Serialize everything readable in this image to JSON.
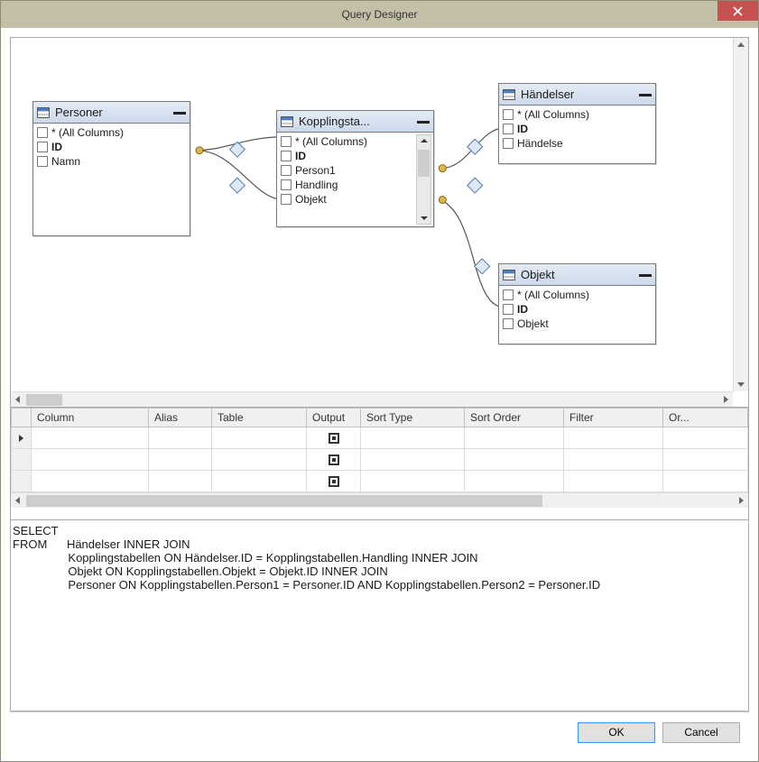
{
  "window": {
    "title": "Query Designer"
  },
  "tables": {
    "personer": {
      "title": "Personer",
      "cols": [
        {
          "label": "* (All Columns)",
          "bold": false
        },
        {
          "label": "ID",
          "bold": true
        },
        {
          "label": "Namn",
          "bold": false
        }
      ]
    },
    "kopplingsta": {
      "title": "Kopplingsta...",
      "cols": [
        {
          "label": "* (All Columns)",
          "bold": false
        },
        {
          "label": "ID",
          "bold": true
        },
        {
          "label": "Person1",
          "bold": false
        },
        {
          "label": "Handling",
          "bold": false
        },
        {
          "label": "Objekt",
          "bold": false
        }
      ]
    },
    "handelser": {
      "title": "Händelser",
      "cols": [
        {
          "label": "* (All Columns)",
          "bold": false
        },
        {
          "label": "ID",
          "bold": true
        },
        {
          "label": "Händelse",
          "bold": false
        }
      ]
    },
    "objekt": {
      "title": "Objekt",
      "cols": [
        {
          "label": "* (All Columns)",
          "bold": false
        },
        {
          "label": "ID",
          "bold": true
        },
        {
          "label": "Objekt",
          "bold": false
        }
      ]
    }
  },
  "grid": {
    "headers": {
      "column": "Column",
      "alias": "Alias",
      "table": "Table",
      "output": "Output",
      "sort_type": "Sort Type",
      "sort_order": "Sort Order",
      "filter": "Filter",
      "or": "Or..."
    }
  },
  "sql": {
    "line1": "SELECT",
    "line2": "FROM      Händelser INNER JOIN",
    "line3": "                 Kopplingstabellen ON Händelser.ID = Kopplingstabellen.Handling INNER JOIN",
    "line4": "                 Objekt ON Kopplingstabellen.Objekt = Objekt.ID INNER JOIN",
    "line5": "                 Personer ON Kopplingstabellen.Person1 = Personer.ID AND Kopplingstabellen.Person2 = Personer.ID"
  },
  "buttons": {
    "ok": "OK",
    "cancel": "Cancel"
  }
}
